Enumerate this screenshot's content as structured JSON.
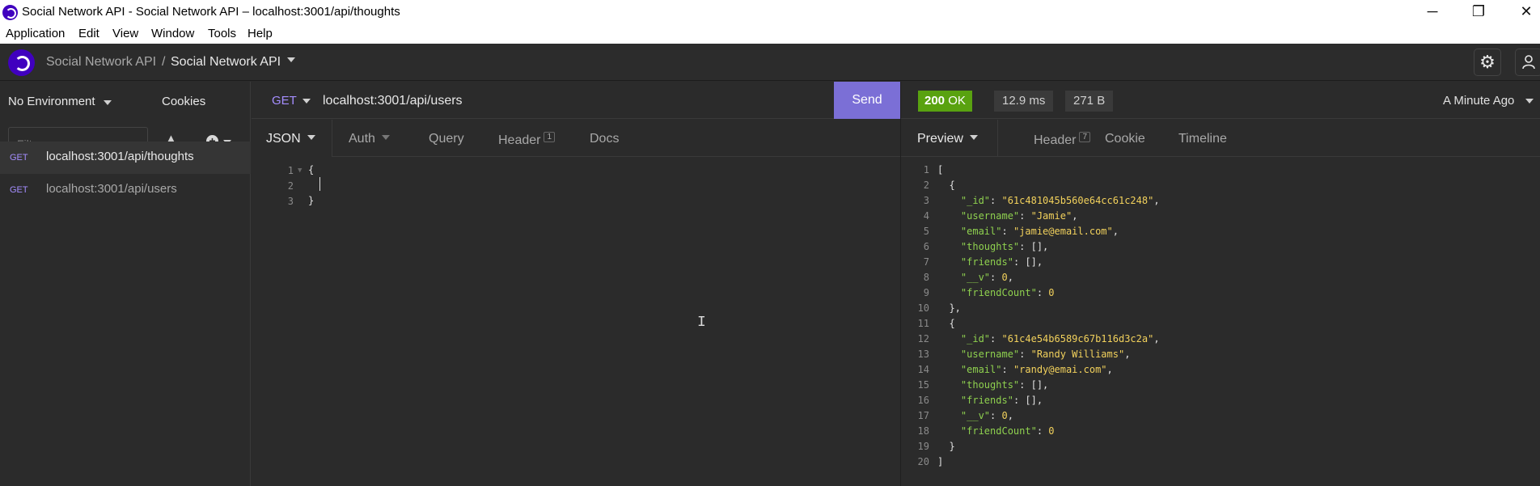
{
  "window": {
    "title": "Social Network API - Social Network API – localhost:3001/api/thoughts",
    "controls": {
      "minimize": "─",
      "restore": "❐",
      "close": "✕"
    }
  },
  "menu": [
    "Application",
    "Edit",
    "View",
    "Window",
    "Tools",
    "Help"
  ],
  "header": {
    "breadcrumb_parent": "Social Network API",
    "breadcrumb_sep": "/",
    "breadcrumb_current": "Social Network API",
    "settings_icon": "⚙",
    "user_icon": "👤"
  },
  "sidebar": {
    "environment": "No Environment",
    "cookies": "Cookies",
    "filter_placeholder": "Filter",
    "requests": [
      {
        "method": "GET",
        "url": "localhost:3001/api/thoughts",
        "active": true
      },
      {
        "method": "GET",
        "url": "localhost:3001/api/users",
        "active": false
      }
    ]
  },
  "request": {
    "method": "GET",
    "url": "localhost:3001/api/users",
    "send_label": "Send",
    "tabs": [
      {
        "label": "JSON"
      },
      {
        "label": "Auth"
      },
      {
        "label": "Query"
      },
      {
        "label": "Header",
        "badge": "1"
      },
      {
        "label": "Docs"
      }
    ],
    "body_lines": [
      {
        "n": "1",
        "text": "{"
      },
      {
        "n": "2",
        "text": ""
      },
      {
        "n": "3",
        "text": "}"
      }
    ]
  },
  "response": {
    "status_code": "200",
    "status_text": "OK",
    "time": "12.9 ms",
    "size": "271 B",
    "when": "A Minute Ago",
    "tabs": [
      {
        "label": "Preview"
      },
      {
        "label": "Header",
        "badge": "7"
      },
      {
        "label": "Cookie"
      },
      {
        "label": "Timeline"
      }
    ],
    "lines": [
      "[",
      "  {",
      "    \"_id\": \"61c481045b560e64cc61c248\",",
      "    \"username\": \"Jamie\",",
      "    \"email\": \"jamie@email.com\",",
      "    \"thoughts\": [],",
      "    \"friends\": [],",
      "    \"__v\": 0,",
      "    \"friendCount\": 0",
      "  },",
      "  {",
      "    \"_id\": \"61c4e54b6589c67b116d3c2a\",",
      "    \"username\": \"Randy Williams\",",
      "    \"email\": \"randy@emai.com\",",
      "    \"thoughts\": [],",
      "    \"friends\": [],",
      "    \"__v\": 0,",
      "    \"friendCount\": 0",
      "  }",
      "]"
    ]
  }
}
